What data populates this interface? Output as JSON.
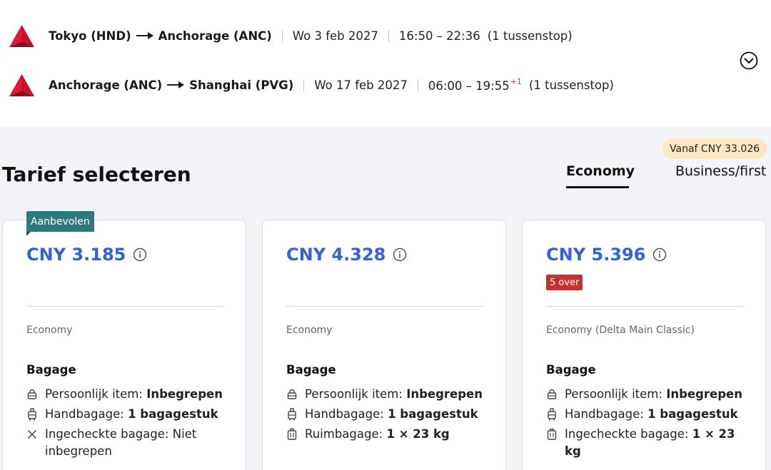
{
  "itinerary": {
    "legs": [
      {
        "from": "Tokyo (HND)",
        "to": "Anchorage (ANC)",
        "date": "Wo 3 feb 2027",
        "time": "16:50 – 22:36",
        "plus_day": "",
        "stops": "(1 tussenstop)"
      },
      {
        "from": "Anchorage (ANC)",
        "to": "Shanghai (PVG)",
        "date": "Wo 17 feb 2027",
        "time": "06:00 – 19:55",
        "plus_day": "+1",
        "stops": "(1 tussenstop)"
      }
    ],
    "expand_icon": "chevron-down-circle-icon"
  },
  "section": {
    "title": "Tarief selecteren",
    "tabs": [
      {
        "label": "Economy",
        "active": true
      },
      {
        "label": "Business/first",
        "active": false,
        "badge": "Vanaf CNY 33.026"
      }
    ]
  },
  "fares": [
    {
      "ribbon": "Aanbevolen",
      "price": "CNY 3.185",
      "seats_left": "",
      "cabin": "Economy",
      "baggage_title": "Bagage",
      "baggage": [
        {
          "icon": "personal-item-icon",
          "label": "Persoonlijk item: ",
          "value": "Inbegrepen"
        },
        {
          "icon": "carry-on-icon",
          "label": "Handbagage: ",
          "value": "1 bagagestuk"
        },
        {
          "icon": "x-icon",
          "label": "Ingecheckte bagage: Niet inbegrepen",
          "value": ""
        }
      ]
    },
    {
      "ribbon": "",
      "price": "CNY 4.328",
      "seats_left": "",
      "cabin": "Economy",
      "baggage_title": "Bagage",
      "baggage": [
        {
          "icon": "personal-item-icon",
          "label": "Persoonlijk item: ",
          "value": "Inbegrepen"
        },
        {
          "icon": "carry-on-icon",
          "label": "Handbagage: ",
          "value": "1 bagagestuk"
        },
        {
          "icon": "checked-bag-icon",
          "label": "Ruimbagage: ",
          "value": "1 × 23 kg"
        }
      ]
    },
    {
      "ribbon": "",
      "price": "CNY 5.396",
      "seats_left": "5 over",
      "cabin": "Economy (Delta Main Classic)",
      "baggage_title": "Bagage",
      "baggage": [
        {
          "icon": "personal-item-icon",
          "label": "Persoonlijk item: ",
          "value": "Inbegrepen"
        },
        {
          "icon": "carry-on-icon",
          "label": "Handbagage: ",
          "value": "1 bagagestuk"
        },
        {
          "icon": "checked-bag-icon",
          "label": "Ingecheckte bagage: ",
          "value": "1 × 23 kg"
        }
      ]
    }
  ],
  "colors": {
    "price": "#3660d8",
    "ribbon": "#2d7a7d",
    "seats_badge": "#c8322c",
    "from_badge": "#fbe8c3",
    "delta_red": "#c8102e"
  }
}
